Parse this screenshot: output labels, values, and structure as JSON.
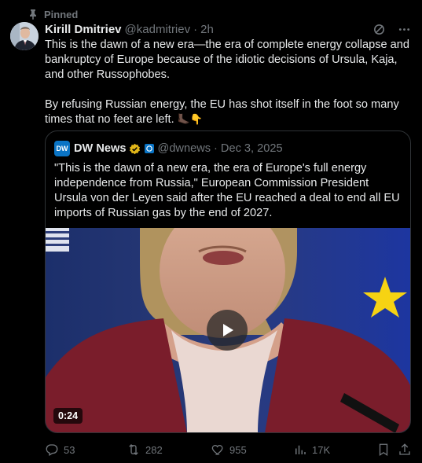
{
  "pinned_label": "Pinned",
  "author": {
    "name": "Kirill Dmitriev",
    "handle": "@kadmitriev",
    "separator": "·",
    "time": "2h"
  },
  "body": {
    "paragraph1": "This is the dawn of a new era—the era of complete energy collapse and bankruptcy of Europe because of the idiotic decisions of Ursula, Kaja, and other Russophobes.",
    "paragraph2": "By refusing Russian energy, the EU has shot itself in the foot so many times that no feet are left.",
    "emojis": "🦶🏿👇"
  },
  "quote": {
    "logo_text": "DW",
    "name": "DW News",
    "handle": "@dwnews",
    "separator": "·",
    "date": "Dec 3, 2025",
    "text": "\"This is the dawn of a new era, the era of Europe's full energy independence from Russia,\" European Commission President Ursula von der Leyen said after the EU reached a deal to end all EU imports of Russian gas by the end of 2027.",
    "video_duration": "0:24"
  },
  "actions": {
    "replies": "53",
    "reposts": "282",
    "likes": "955",
    "views": "17K"
  },
  "colors": {
    "background": "#000000",
    "text": "#e7e9ea",
    "muted": "#71767b",
    "border": "#2f3336",
    "verified_gold": "#e2b719",
    "dw_blue": "#0a74c5"
  }
}
